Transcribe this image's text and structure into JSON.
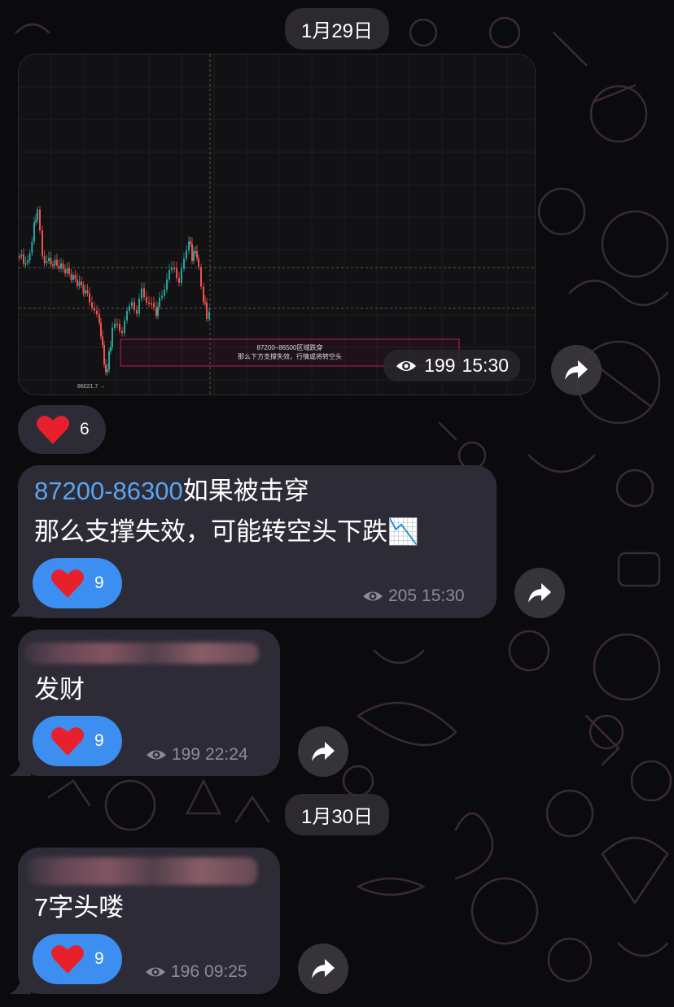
{
  "dates": [
    "1月29日",
    "1月30日"
  ],
  "chart_message": {
    "views": "199",
    "time": "15:30",
    "reaction_count": "6",
    "box_line1": "87200–86500区域跌穿",
    "box_line2": "那么下方支撑失效，行情或将转空头",
    "low_label": "86021.7 →"
  },
  "message1": {
    "link": "87200-86300",
    "line1_rest": "如果被击穿",
    "line2": "那么支撑失效，可能转空头下跌📉",
    "reaction_count": "9",
    "views": "205",
    "time": "15:30"
  },
  "message2": {
    "text": "发财",
    "reaction_count": "9",
    "views": "199",
    "time": "22:24"
  },
  "message3": {
    "text": "7字头喽",
    "reaction_count": "9",
    "views": "196",
    "time": "09:25"
  },
  "colors": {
    "accent": "#3c8ef0",
    "link": "#5aa5f0",
    "bubble": "#2d2b36",
    "heart": "#e8202c"
  }
}
